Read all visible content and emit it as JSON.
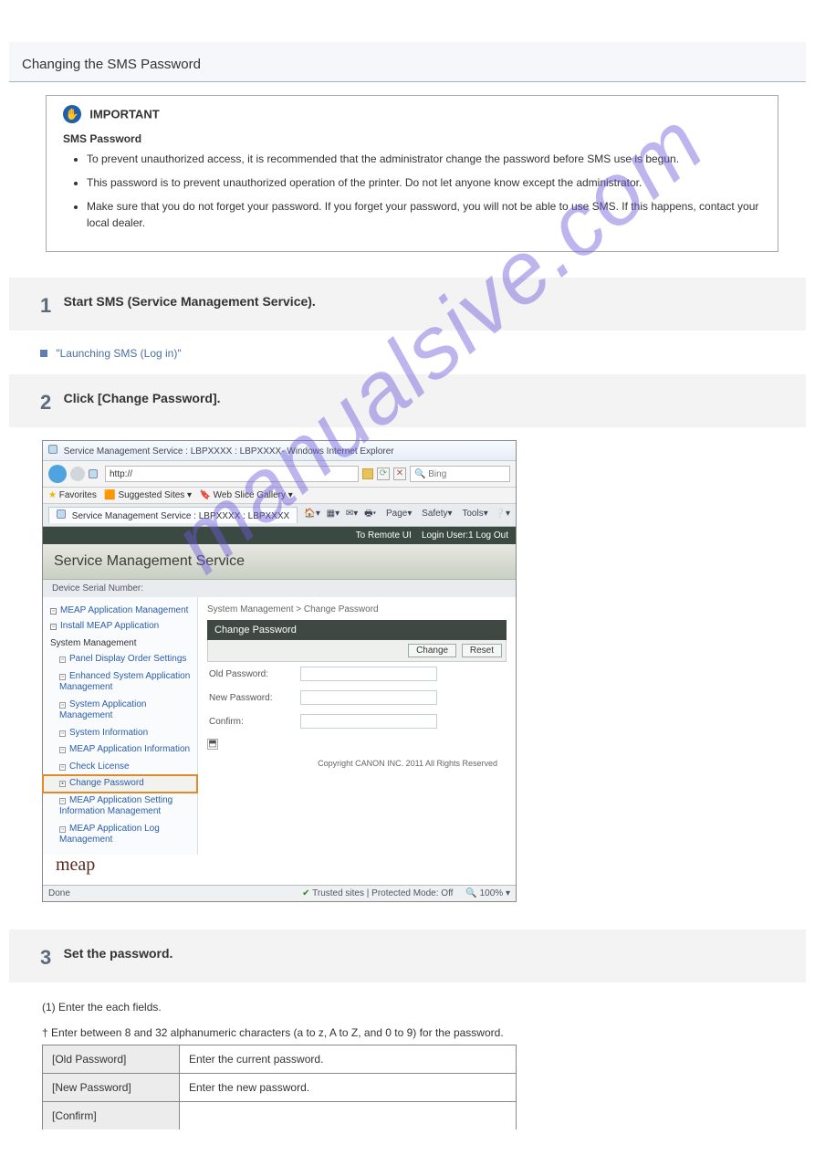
{
  "topic_id": "0AWU-0JS",
  "page_title": "Changing the SMS Password",
  "important": {
    "label": "IMPORTANT",
    "subtitle": "SMS Password",
    "bullets": [
      "To prevent unauthorized access, it is recommended that the administrator change the password before SMS use is begun.",
      "This password is to prevent unauthorized operation of the printer. Do not let anyone know except the administrator.",
      "Make sure that you do not forget your password. If you forget your password, you will not be able to use SMS. If this happens, contact your local dealer."
    ]
  },
  "steps": {
    "s1": {
      "num": "1",
      "title": "Start SMS (Service Management Service).",
      "link_label": "\"Launching SMS (Log in)\""
    },
    "s2": {
      "num": "2",
      "title": "Click [Change Password]."
    },
    "s3": {
      "num": "3",
      "title": "Set the password."
    }
  },
  "screenshot": {
    "window_title": "Service Management Service : LBPXXXX : LBPXXXX- Windows Internet Explorer",
    "url_prefix": "http://",
    "search_engine": "Bing",
    "fav_label": "Favorites",
    "suggested": "Suggested Sites",
    "webslice": "Web Slice Gallery",
    "tab_title": "Service Management Service : LBPXXXX : LBPXXXX",
    "ie_tools": {
      "page": "Page",
      "safety": "Safety",
      "tools": "Tools"
    },
    "topbar": {
      "remote": "To Remote UI",
      "login": "Login User:1 Log Out"
    },
    "sms_title": "Service Management Service",
    "device_serial": "Device Serial Number:",
    "nav": {
      "meap_mgmt": "MEAP Application Management",
      "install": "Install MEAP Application",
      "sys_mgmt": "System Management",
      "panel": "Panel Display Order Settings",
      "enhanced": "Enhanced System Application Management",
      "sys_app": "System Application Management",
      "sys_info": "System Information",
      "meap_info": "MEAP Application Information",
      "check_lic": "Check License",
      "change_pw": "Change Password",
      "setting_info": "MEAP Application Setting Information Management",
      "log_mgmt": "MEAP Application Log Management"
    },
    "breadcrumb": "System Management > Change Password",
    "pane_title": "Change Password",
    "buttons": {
      "change": "Change",
      "reset": "Reset"
    },
    "form": {
      "old": "Old Password:",
      "new": "New Password:",
      "confirm": "Confirm:"
    },
    "copyright": "Copyright CANON INC. 2011 All Rights Reserved",
    "meap_logo": "meap",
    "status_done": "Done",
    "status_zone": "Trusted sites | Protected Mode: Off",
    "zoom": "100%"
  },
  "step3_body": {
    "line1": "(1) Enter the each fields.",
    "dagger_note": "Enter between 8 and 32 alphanumeric characters (a to z, A to Z, and 0 to 9) for the password.",
    "table": {
      "old": {
        "label": "[Old Password]",
        "desc": "Enter the current password."
      },
      "new": {
        "label": "[New Password]",
        "desc": "Enter the new password."
      },
      "confirm": {
        "label": "[Confirm]",
        "desc": ""
      }
    }
  }
}
